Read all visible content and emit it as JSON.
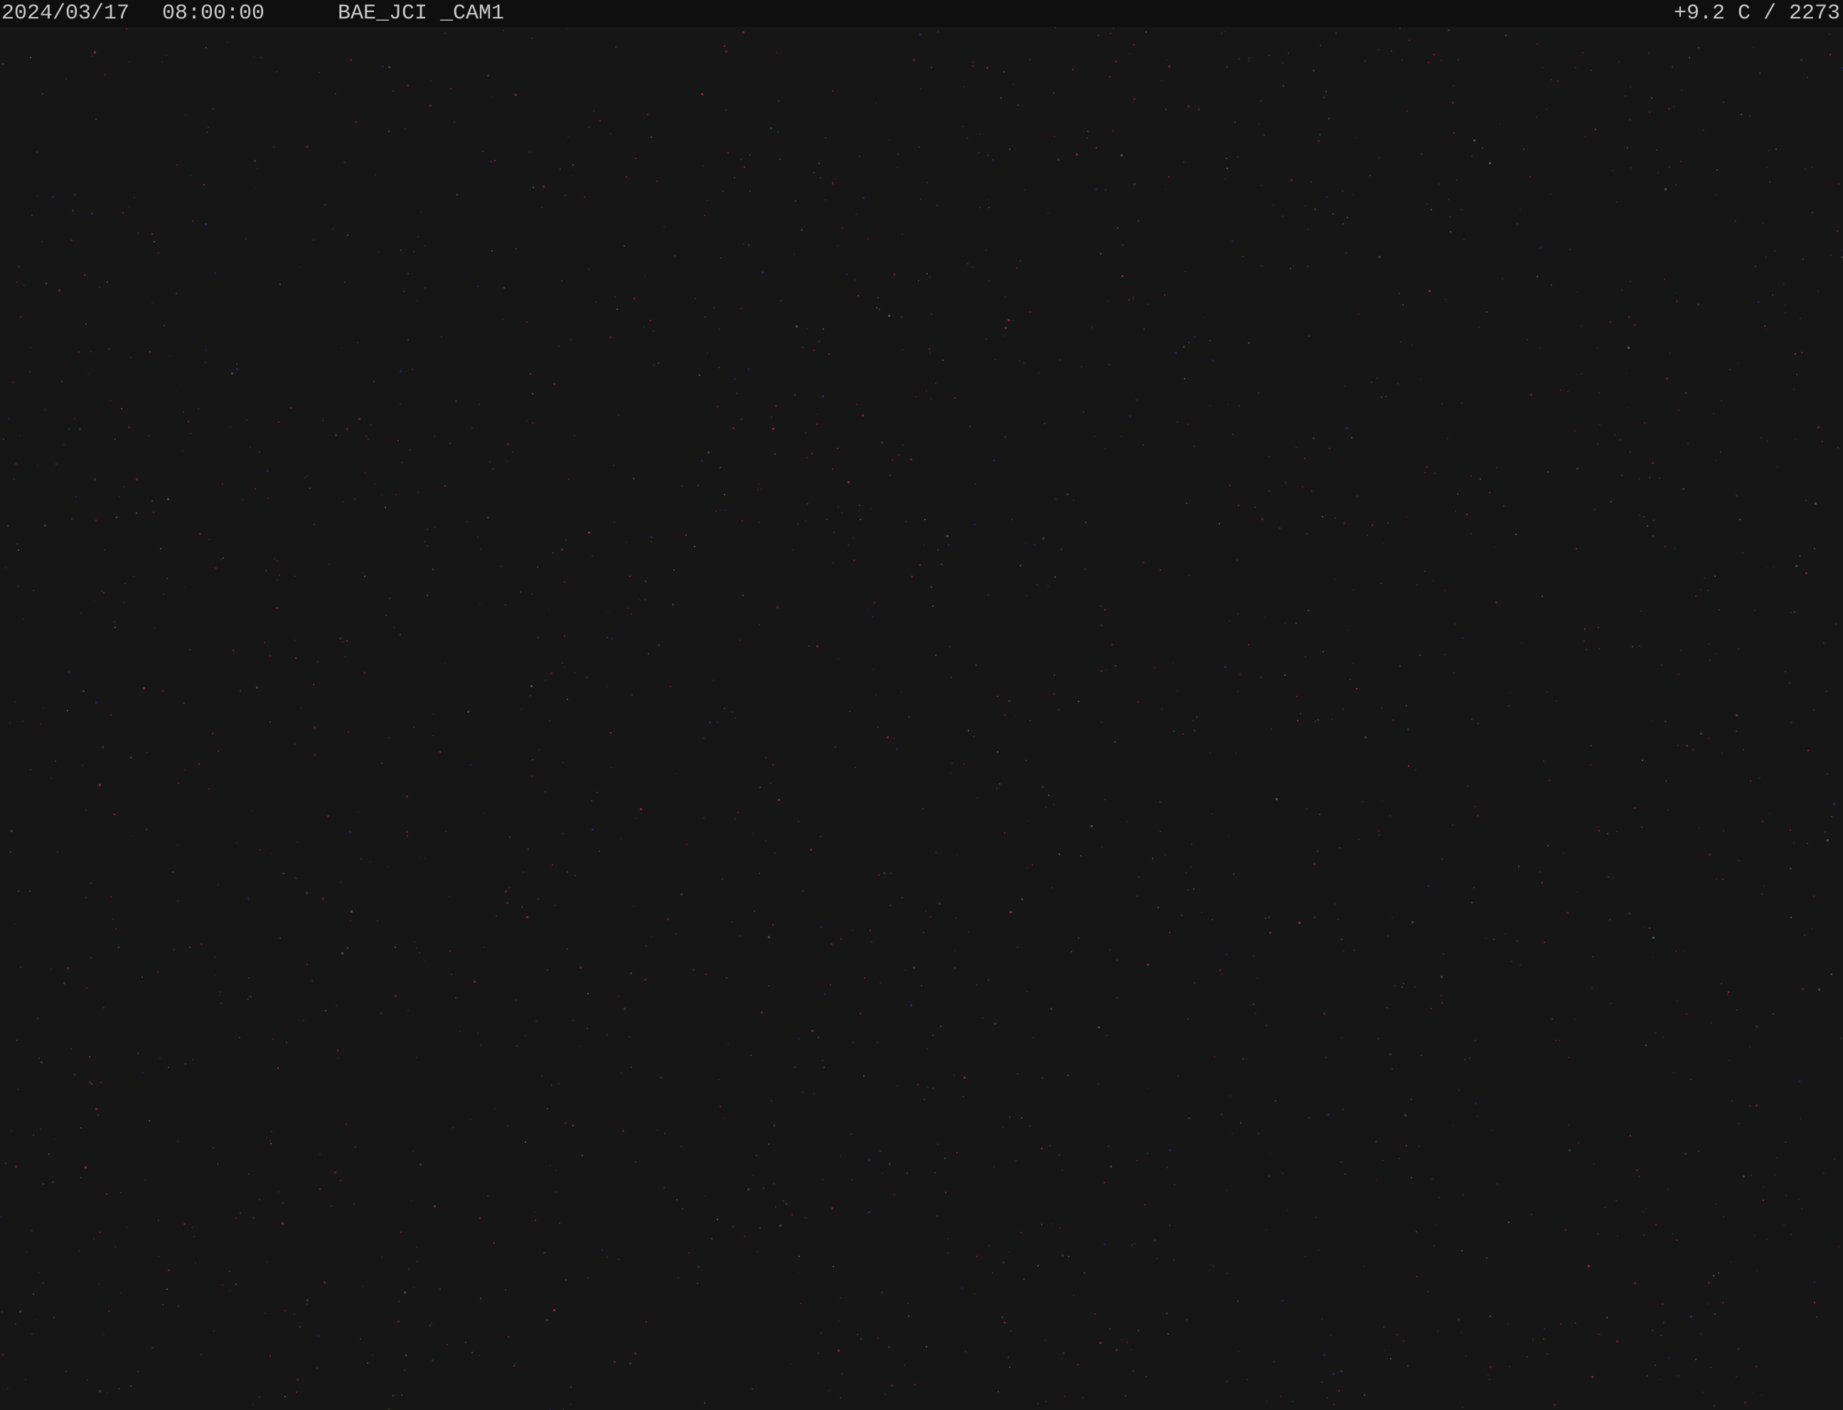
{
  "osd": {
    "date": "2024/03/17",
    "time": "08:00:00",
    "camera_id": "BAE_JCI _CAM1",
    "readout": "+9.2 C / 2273"
  },
  "scene": {
    "description_color": "#161616",
    "speckle_colors": [
      "#7a1f2a",
      "#2a4a2a",
      "#2a2a6a",
      "#5a5a5a",
      "#a02838"
    ]
  }
}
